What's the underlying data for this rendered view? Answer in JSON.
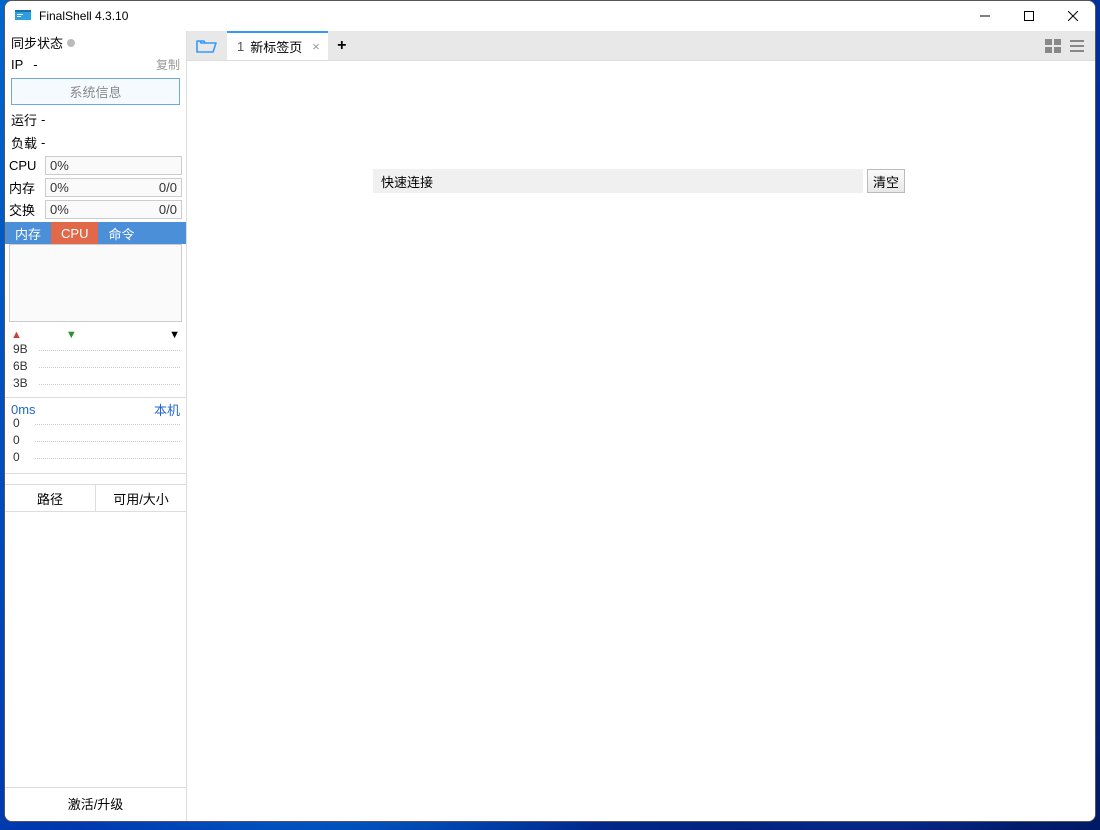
{
  "window": {
    "title": "FinalShell 4.3.10"
  },
  "sidebar": {
    "sync_label": "同步状态",
    "ip_label": "IP",
    "ip_value": "-",
    "copy_label": "复制",
    "sysinfo_button": "系统信息",
    "runtime_label": "运行",
    "runtime_value": "-",
    "load_label": "负载",
    "load_value": "-",
    "meters": {
      "cpu": {
        "label": "CPU",
        "pct": "0%"
      },
      "mem": {
        "label": "内存",
        "pct": "0%",
        "ratio": "0/0"
      },
      "swap": {
        "label": "交换",
        "pct": "0%",
        "ratio": "0/0"
      }
    },
    "chart_tabs": {
      "memory": "内存",
      "cpu": "CPU",
      "cmd": "命令"
    },
    "net_y": [
      "9B",
      "6B",
      "3B"
    ],
    "ping_label": "0ms",
    "local_label": "本机",
    "ping_y": [
      "0",
      "0",
      "0"
    ],
    "disk_cols": {
      "path": "路径",
      "size": "可用/大小"
    },
    "footer": "激活/升级"
  },
  "tabs": {
    "active": {
      "index": "1",
      "label": "新标签页"
    }
  },
  "main": {
    "quick_connect_label": "快速连接",
    "clear_button": "清空"
  }
}
